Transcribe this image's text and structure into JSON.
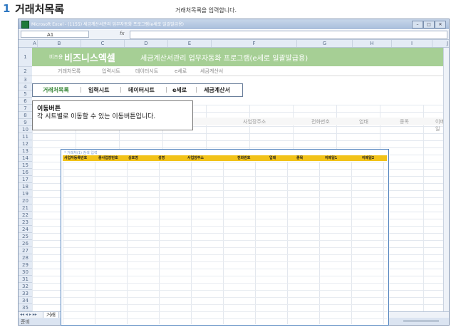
{
  "page_header": {
    "number": "1",
    "title": "거래처목록",
    "description": "거래처목록을 입력합니다."
  },
  "excel": {
    "window_title": "Microsoft Excel - (1155) 세금계산서관리 업무자동화 프로그램(e세로 일괄발급용)",
    "name_box": "A1",
    "fx_label": "fx",
    "columns": [
      "A",
      "B",
      "C",
      "D",
      "E",
      "F",
      "G",
      "H",
      "I",
      "J"
    ],
    "rows": [
      "1",
      "2",
      "3",
      "4",
      "5",
      "6",
      "7",
      "8",
      "9",
      "10",
      "11",
      "12",
      "13",
      "14",
      "15",
      "16",
      "17",
      "18",
      "19",
      "20",
      "21",
      "22",
      "23",
      "24",
      "25",
      "26",
      "27",
      "28",
      "29",
      "30",
      "31",
      "32",
      "33",
      "34",
      "35",
      "36",
      "37",
      "38",
      "39"
    ],
    "sheet_tab": "거래",
    "status_text": "준비"
  },
  "banner": {
    "edition": "비즈용",
    "brand": "비즈니스엑셀",
    "title": "세금계산서관리 업무자동화 프로그램(e세로 일괄발급용)"
  },
  "subnav": [
    "거래처목록",
    "입력시트",
    "데이터시트",
    "e세로",
    "세금계산서"
  ],
  "nav_buttons": [
    "거래처목록",
    "입력시트",
    "데이터시트",
    "e세로",
    "세금계산서"
  ],
  "row6_headers": [
    "사업장주소",
    "전화번호",
    "업태",
    "종목",
    "이메일"
  ],
  "tooltip": {
    "heading": "이동버튼",
    "body": "각 시트별로 이동할 수 있는 이동버튼입니다."
  },
  "dialog": {
    "caption": "* 거래처(1) 검색 입력",
    "columns": [
      "사업자등록번호",
      "종사업장번호",
      "상호명",
      "성명",
      "사업장주소",
      "전화번호",
      "업태",
      "종목",
      "이메일1",
      "이메일2"
    ]
  },
  "colors": {
    "banner": "#a6cf95",
    "dialog_header": "#f2c218",
    "accent": "#2e78c2"
  }
}
